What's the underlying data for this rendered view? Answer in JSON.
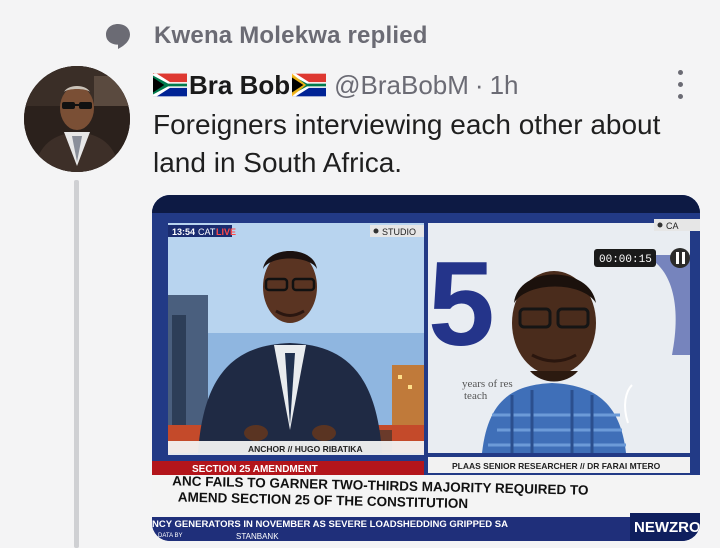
{
  "context": {
    "icon": "comment-bubble-icon",
    "text": "Kwena Molekwa replied"
  },
  "tweet": {
    "author_name": "Bra Bob",
    "author_handle": "@BraBobM",
    "separator": "·",
    "time": "1h",
    "text": "Foreigners interviewing each other about land in South Africa.",
    "flag_icon": "south-africa-flag-icon",
    "more_icon": "more-options-icon"
  },
  "media": {
    "clock": "13:54",
    "timezone": "CAT",
    "live": "LIVE",
    "studio_label": "STUDIO",
    "anchor_caption": "ANCHOR // HUGO RIBATIKA",
    "guest_caption": "PLAAS SENIOR RESEARCHER // DR FARAI MTERO",
    "timer": "00:00:15",
    "right_location": "CA",
    "backdrop_number": "5",
    "backdrop_text": "years of res",
    "backdrop_text2": "teach",
    "section_tag": "SECTION 25 AMENDMENT",
    "headline_line1": "ANC FAILS TO GARNER TWO-THIRDS MAJORITY REQUIRED TO",
    "headline_line2": "AMEND SECTION 25 OF THE CONSTITUTION",
    "ticker": "NCY GENERATORS IN NOVEMBER AS SEVERE LOADSHEDDING GRIPPED SA",
    "ticker_small": "DATA BY",
    "ticker_bottom": "STANBANK",
    "logo": "NEWZRO",
    "colors": {
      "bar_red": "#b3151b",
      "panel_blue": "#1f2f7a"
    }
  }
}
